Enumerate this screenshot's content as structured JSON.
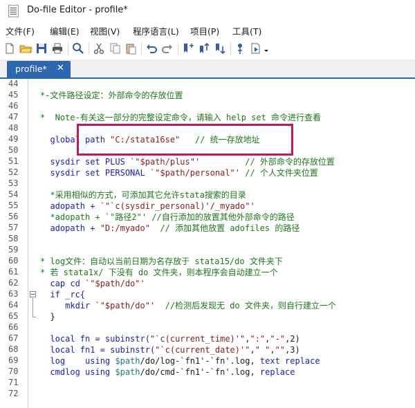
{
  "window": {
    "title": "Do-file Editor - profile*"
  },
  "menu": [
    "文件(F)",
    "编辑(E)",
    "视图(V)",
    "程序语言(L)",
    "项目(P)",
    "工具(T)"
  ],
  "toolbar": {
    "icons": [
      "new-file-icon",
      "open-folder-icon",
      "save-icon",
      "print-icon",
      "find-icon",
      "cut-icon",
      "copy-icon",
      "paste-icon",
      "undo-icon",
      "redo-icon",
      "bookmark-toggle-icon",
      "bookmark-next-icon",
      "bookmark-prev-icon",
      "show-file-icon",
      "execute-icon",
      "dropdown-arrow-icon"
    ]
  },
  "tab": {
    "label": "profile*",
    "close": "✕"
  },
  "editor": {
    "lines": [
      {
        "n": "44",
        "segs": []
      },
      {
        "n": "45",
        "segs": [
          {
            "t": "*-文件路径设定：外部命令的存放位置",
            "c": "c-cmt"
          }
        ]
      },
      {
        "n": "46",
        "segs": []
      },
      {
        "n": "47",
        "segs": [
          {
            "t": "*  Note-有关这一部分的完整设定命令，请输入 help set 命令进行查看",
            "c": "c-cmt"
          }
        ]
      },
      {
        "n": "48",
        "segs": []
      },
      {
        "n": "49",
        "segs": [
          {
            "t": "  global path ",
            "c": "c-kw"
          },
          {
            "t": "\"C:/stata16se\"",
            "c": "c-str"
          },
          {
            "t": "   // 统一存放地址",
            "c": "c-cmt"
          }
        ]
      },
      {
        "n": "50",
        "segs": []
      },
      {
        "n": "51",
        "segs": [
          {
            "t": "  sysdir set PLUS ",
            "c": "c-kw"
          },
          {
            "t": "`\"$path/plus\"'",
            "c": "c-str"
          },
          {
            "t": "         // 外部命令的存放位置",
            "c": "c-cmt"
          }
        ]
      },
      {
        "n": "52",
        "segs": [
          {
            "t": "  sysdir set PERSONAL ",
            "c": "c-kw"
          },
          {
            "t": "`\"$path/personal\"'",
            "c": "c-str"
          },
          {
            "t": " // 个人文件夹位置",
            "c": "c-cmt"
          }
        ]
      },
      {
        "n": "53",
        "segs": []
      },
      {
        "n": "54",
        "segs": [
          {
            "t": "  *采用相似的方式，可添加其它允许stata搜索的目录",
            "c": "c-cmt"
          }
        ]
      },
      {
        "n": "55",
        "segs": [
          {
            "t": "  adopath + ",
            "c": "c-kw"
          },
          {
            "t": "`\"`c(sysdir_personal)'/_myado\"'",
            "c": "c-str"
          }
        ]
      },
      {
        "n": "56",
        "segs": [
          {
            "t": "  *adopath + `\"路径2\"' //自行添加的放置其他外部命令的路径",
            "c": "c-cmt"
          }
        ]
      },
      {
        "n": "57",
        "segs": [
          {
            "t": "  adopath + ",
            "c": "c-kw"
          },
          {
            "t": "\"D:/myado\"",
            "c": "c-str"
          },
          {
            "t": "  // 添加其他放置 adofiles 的路径",
            "c": "c-cmt"
          }
        ]
      },
      {
        "n": "58",
        "segs": []
      },
      {
        "n": "59",
        "segs": []
      },
      {
        "n": "60",
        "segs": [
          {
            "t": "* log文件：自动以当前日期为名存放于 stata15/do 文件夹下",
            "c": "c-cmt"
          }
        ]
      },
      {
        "n": "61",
        "segs": [
          {
            "t": "* 若 stata1x/ 下没有 do 文件夹，则本程序会自动建立一个",
            "c": "c-cmt"
          }
        ]
      },
      {
        "n": "62",
        "segs": [
          {
            "t": "  cap cd ",
            "c": "c-kw"
          },
          {
            "t": "`\"$path/do\"'",
            "c": "c-str"
          }
        ]
      },
      {
        "n": "63",
        "segs": [
          {
            "t": "  if _rc{",
            "c": "c-kw"
          }
        ]
      },
      {
        "n": "64",
        "segs": [
          {
            "t": "     mkdir ",
            "c": "c-kw"
          },
          {
            "t": "`\"$path/do\"'",
            "c": "c-str"
          },
          {
            "t": "  //检测后发现无 do 文件夹，则自行建立一个",
            "c": "c-cmt"
          }
        ]
      },
      {
        "n": "65",
        "segs": [
          {
            "t": "  }",
            "c": "c-plain"
          }
        ]
      },
      {
        "n": "66",
        "segs": []
      },
      {
        "n": "67",
        "segs": [
          {
            "t": "  local fn = subinstr(",
            "c": "c-kw"
          },
          {
            "t": "\"`c(current_time)'\"",
            "c": "c-str"
          },
          {
            "t": ",",
            "c": "c-plain"
          },
          {
            "t": "\":\"",
            "c": "c-str"
          },
          {
            "t": ",",
            "c": "c-plain"
          },
          {
            "t": "\"-\"",
            "c": "c-str"
          },
          {
            "t": ",2)",
            "c": "c-plain"
          }
        ]
      },
      {
        "n": "68",
        "segs": [
          {
            "t": "  local fn1 = subinstr(",
            "c": "c-kw"
          },
          {
            "t": "\"`c(current_date)'\"",
            "c": "c-str"
          },
          {
            "t": ",",
            "c": "c-plain"
          },
          {
            "t": "\" \"",
            "c": "c-str"
          },
          {
            "t": ",",
            "c": "c-plain"
          },
          {
            "t": "\"\"",
            "c": "c-str"
          },
          {
            "t": ",3)",
            "c": "c-plain"
          }
        ]
      },
      {
        "n": "69",
        "segs": [
          {
            "t": "  log    using ",
            "c": "c-kw"
          },
          {
            "t": "$path",
            "c": "c-macro"
          },
          {
            "t": "/do/log-`fn1'-`fn'.log, ",
            "c": "c-plain"
          },
          {
            "t": "text replace",
            "c": "c-kw"
          }
        ]
      },
      {
        "n": "70",
        "segs": [
          {
            "t": "  cmdlog using ",
            "c": "c-kw"
          },
          {
            "t": "$path",
            "c": "c-macro"
          },
          {
            "t": "/do/cmd-`fn1'-`fn'.log, ",
            "c": "c-plain"
          },
          {
            "t": "replace",
            "c": "c-kw"
          }
        ]
      },
      {
        "n": "71",
        "segs": []
      },
      {
        "n": "72",
        "segs": []
      }
    ]
  }
}
